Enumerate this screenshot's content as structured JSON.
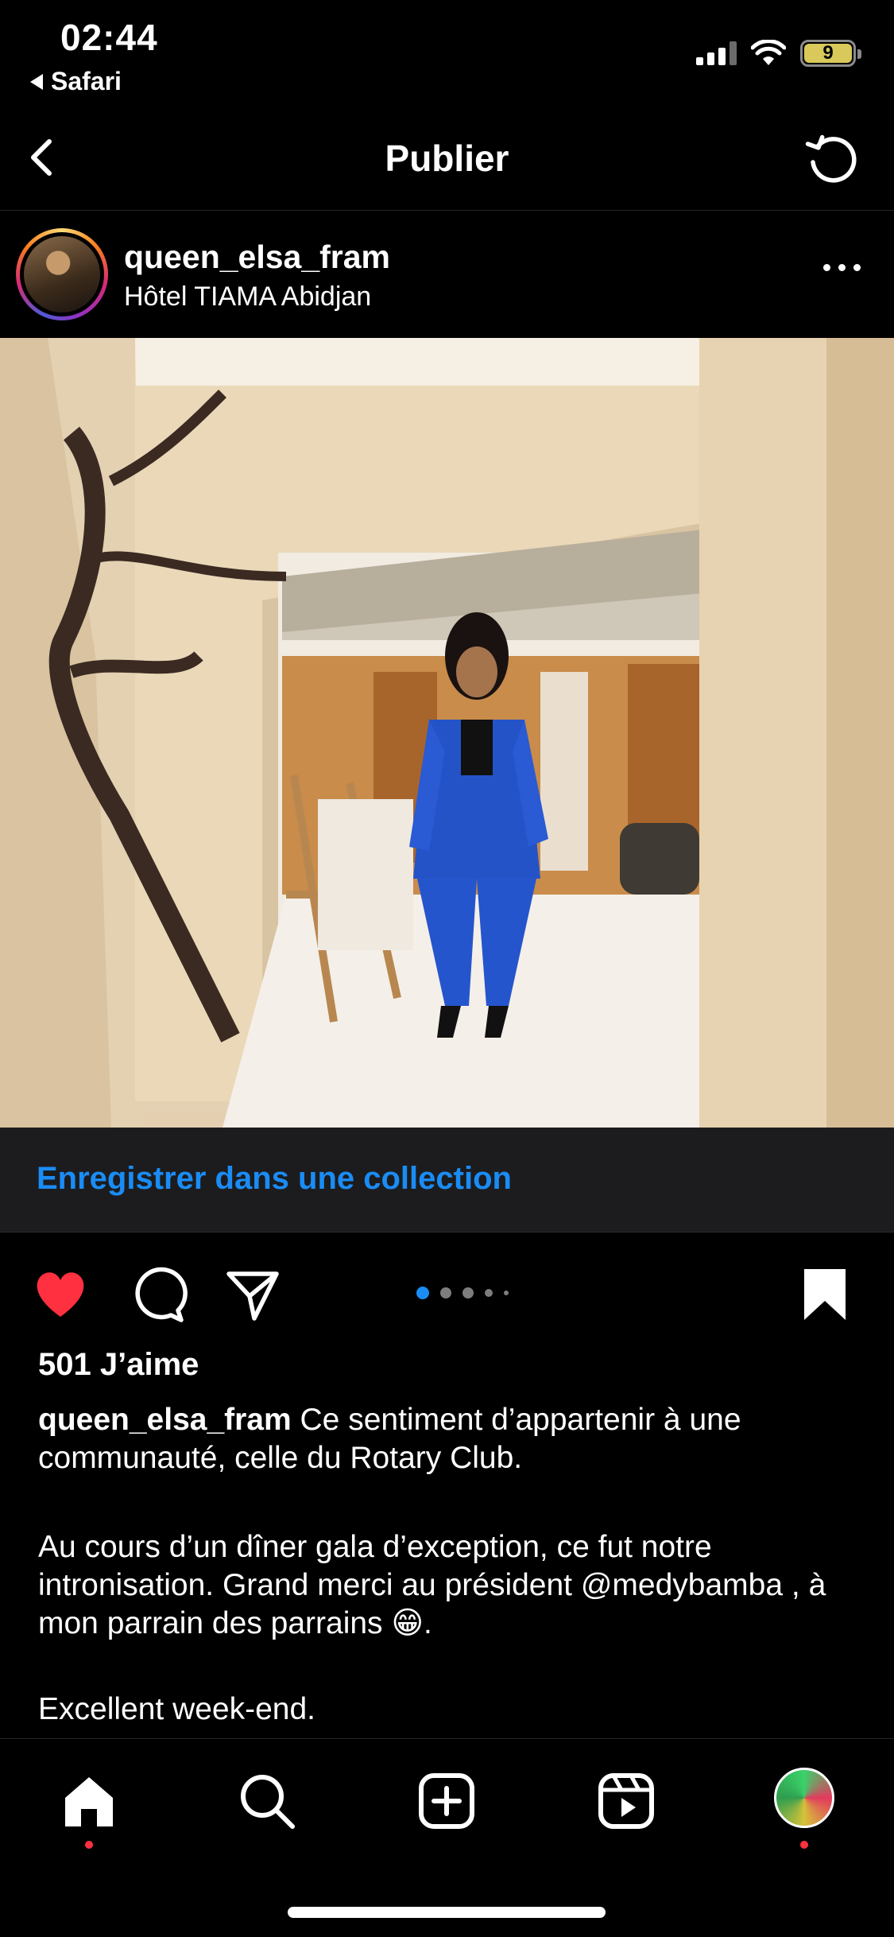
{
  "status_bar": {
    "time": "02:44",
    "back_app": "Safari",
    "battery_level": "9"
  },
  "header": {
    "title": "Publier"
  },
  "post": {
    "username": "queen_elsa_fram",
    "location": "Hôtel TIAMA Abidjan",
    "photo_alt": "Femme en tailleur bleu dans le hall d'un hôtel",
    "carousel": {
      "total": 5,
      "current": 1
    },
    "save_collection_label": "Enregistrer dans une collection",
    "likes": "501 J’aime",
    "caption_user": "queen_elsa_fram",
    "caption_line1": " Ce sentiment d’appartenir à une communauté, celle du Rotary Club.",
    "para2_a": "Au cours d’un dîner gala d’exception, ce fut notre intronisation. Grand merci au président ",
    "mention": "@medybamba",
    "para2_b": " , à mon parrain des parrains 😁.",
    "para3": "Excellent week-end."
  },
  "icons": {
    "like": "heart-filled-icon",
    "comment": "comment-bubble-icon",
    "share": "paper-plane-icon",
    "save": "bookmark-filled-icon"
  },
  "colors": {
    "like": "#ff3040",
    "link": "#1a8cf5",
    "carousel_active": "#1a8cf5"
  },
  "tabbar": {
    "items": [
      "home",
      "search",
      "create",
      "reels",
      "profile"
    ]
  }
}
